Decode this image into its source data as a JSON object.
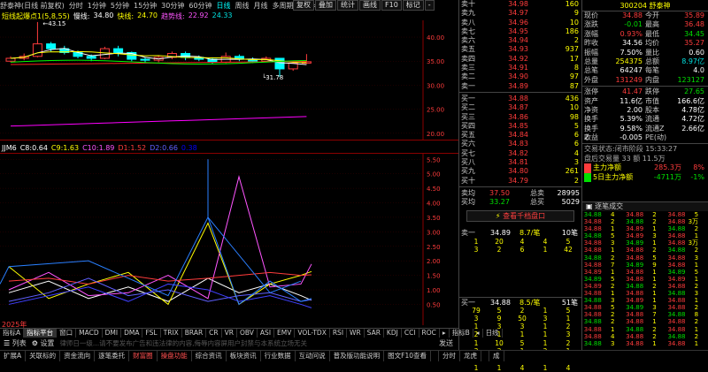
{
  "topbar": {
    "stock": "舒泰神(日线 前复权)",
    "periods": [
      "分时",
      "1分钟",
      "5分钟",
      "15分钟",
      "30分钟",
      "60分钟",
      "日线",
      "周线",
      "月线",
      "多周期",
      "更多>"
    ],
    "active": "日线",
    "right_tabs": [
      "复权",
      "叠加",
      "统计",
      "画线",
      "F10",
      "标记",
      "-"
    ]
  },
  "indicator": {
    "name": "短线起爆点1(5,8,55)",
    "slow_label": "慢线:",
    "slow": "34.80",
    "fast_label": "快线:",
    "fast": "24.70",
    "trend_label": "趋势线:",
    "trend": "22.92",
    "extra": "24.33"
  },
  "subind": {
    "name": "JJM6",
    "items": [
      {
        "label": "C8:",
        "value": "0.64",
        "color": "#ffffff"
      },
      {
        "label": "C9:",
        "value": "1.63",
        "color": "#ffff00"
      },
      {
        "label": "C10:",
        "value": "1.89",
        "color": "#ff55ff"
      },
      {
        "label": "D1:",
        "value": "1.52",
        "color": "#ff3c3c"
      },
      {
        "label": "D2:",
        "value": "0.66",
        "color": "#6060ff"
      },
      {
        "label": "",
        "value": "0.38",
        "color": "#0000ff"
      }
    ]
  },
  "main_axis": [
    "40.00",
    "35.00",
    "30.00",
    "25.00",
    "20.00"
  ],
  "sub_axis": [
    "5.50",
    "5.00",
    "4.50",
    "4.00",
    "3.50",
    "3.00",
    "2.50",
    "2.00",
    "1.50",
    "1.00",
    "0.50"
  ],
  "annot": {
    "high": "43.15",
    "low": "31.78"
  },
  "year": "2025年",
  "tabs1": [
    "指标A",
    "指标平台",
    "窗口",
    "MACD",
    "DMI",
    "DMA",
    "FSL",
    "TRIX",
    "BRAR",
    "CR",
    "VR",
    "OBV",
    "ASI",
    "EMV",
    "VOL-TDX",
    "RSI",
    "WR",
    "SAR",
    "KDJ",
    "CCI",
    "ROC",
    "▸",
    "指标B",
    "◂"
  ],
  "tabs1_right": "日线",
  "tabs2": {
    "list": "列表",
    "settings": "设置",
    "ticker": "律师日一级...请不要发布广告和违法律的内容,侮辱内容屏用户封禁与本系统立场无关",
    "send": "发送"
  },
  "bottombar": [
    "扩展A",
    "关联标的",
    "资金流向",
    "逐笔委托",
    "财富圈",
    "操盘功能",
    "综合资讯",
    "板块资讯",
    "行业数据",
    "互动问说",
    "普及版功能说明",
    "图文F10查看",
    "",
    "分时",
    "龙虎",
    "",
    "成"
  ],
  "book": {
    "sell": [
      {
        "l": "卖十",
        "p": "34.98",
        "v": "160"
      },
      {
        "l": "卖九",
        "p": "34.97",
        "v": "9"
      },
      {
        "l": "卖八",
        "p": "34.96",
        "v": "10"
      },
      {
        "l": "卖七",
        "p": "34.95",
        "v": "186"
      },
      {
        "l": "卖六",
        "p": "34.94",
        "v": "2"
      },
      {
        "l": "卖五",
        "p": "34.93",
        "v": "937"
      },
      {
        "l": "卖四",
        "p": "34.92",
        "v": "17"
      },
      {
        "l": "卖三",
        "p": "34.91",
        "v": "8"
      },
      {
        "l": "卖二",
        "p": "34.90",
        "v": "97"
      },
      {
        "l": "卖一",
        "p": "34.89",
        "v": "87"
      }
    ],
    "buy": [
      {
        "l": "买一",
        "p": "34.88",
        "v": "436"
      },
      {
        "l": "买二",
        "p": "34.87",
        "v": "10"
      },
      {
        "l": "买三",
        "p": "34.86",
        "v": "98"
      },
      {
        "l": "买四",
        "p": "34.85",
        "v": "5"
      },
      {
        "l": "买五",
        "p": "34.84",
        "v": "6"
      },
      {
        "l": "买六",
        "p": "34.83",
        "v": "6"
      },
      {
        "l": "买七",
        "p": "34.82",
        "v": "4"
      },
      {
        "l": "买八",
        "p": "34.81",
        "v": "3"
      },
      {
        "l": "买九",
        "p": "34.80",
        "v": "261"
      },
      {
        "l": "买十",
        "p": "34.79",
        "v": "2"
      }
    ],
    "avg": [
      {
        "l": "卖均",
        "p": "37.50",
        "m": "总卖",
        "v": "28995"
      },
      {
        "l": "买均",
        "p": "33.27",
        "m": "总买",
        "v": "5029"
      }
    ]
  },
  "quote": {
    "code": "300204",
    "name": "舒泰神",
    "rows": [
      {
        "a": "现价",
        "b": "34.88",
        "bc": "#ff3c3c",
        "c": "今开",
        "d": "35.89",
        "dc": "#ff3c3c"
      },
      {
        "a": "涨跌",
        "b": "-0.01",
        "bc": "#00e000",
        "c": "最高",
        "d": "36.48",
        "dc": "#ff3c3c"
      },
      {
        "a": "涨幅",
        "b": "0.93%",
        "bc": "#ff3c3c",
        "c": "最低",
        "d": "34.45",
        "dc": "#00e000"
      },
      {
        "a": "昨收",
        "b": "34.56",
        "bc": "#fff",
        "c": "均价",
        "d": "35.27",
        "dc": "#ff3c3c"
      },
      {
        "a": "振幅",
        "b": "7.50%",
        "bc": "#fff",
        "c": "量比",
        "d": "0.60",
        "dc": "#fff"
      },
      {
        "a": "总量",
        "b": "254375",
        "bc": "#ffff00",
        "c": "总额",
        "d": "8.97亿",
        "dc": "#00e0e0"
      },
      {
        "a": "总笔",
        "b": "64247",
        "bc": "#fff",
        "c": "每笔",
        "d": "4.0",
        "dc": "#fff"
      },
      {
        "a": "外盘",
        "b": "131249",
        "bc": "#ff3c3c",
        "c": "内盘",
        "d": "123127",
        "dc": "#00e000"
      }
    ],
    "rows2": [
      {
        "a": "涨停",
        "b": "41.47",
        "bc": "#ff3c3c",
        "c": "跌停",
        "d": "27.65",
        "dc": "#00e000"
      },
      {
        "a": "资产",
        "b": "11.6亿",
        "bc": "#fff",
        "c": "市值",
        "d": "166.6亿",
        "dc": "#fff"
      },
      {
        "a": "净资",
        "b": "2.00",
        "bc": "#fff",
        "c": "股本",
        "d": "4.78亿",
        "dc": "#fff"
      },
      {
        "a": "换手",
        "b": "5.39%",
        "bc": "#fff",
        "c": "流通",
        "d": "4.72亿",
        "dc": "#fff"
      },
      {
        "a": "换手Z",
        "b": "9.58%",
        "bc": "#fff",
        "c": "流通Z",
        "d": "2.66亿",
        "dc": "#fff"
      },
      {
        "a": "收益",
        "b": "-0.005",
        "bc": "#fff",
        "c": "PE(动)",
        "d": "",
        "dc": "#fff"
      }
    ],
    "status": "交易状态:闭市阶段 15:33:27",
    "after": "盘后交易量 33 额 11.5万",
    "mainflow_label": "主力净额",
    "mainflow_v": "285.3万",
    "mainflow_p": "8%",
    "flow5_label": "5日主力净额",
    "flow5_v": "-4711万",
    "flow5_p": "-1%"
  },
  "qd": {
    "btn": "查看千档盘口",
    "sell_h": {
      "l": "卖一",
      "p": "34.89",
      "n": "8.7/笔",
      "c": "10笔"
    },
    "sell_g": [
      [
        "1",
        "20",
        "4",
        "4",
        "5"
      ],
      [
        "3",
        "2",
        "6",
        "1",
        "42"
      ]
    ],
    "buy_h": {
      "l": "买一",
      "p": "34.88",
      "n": "8.5/笔",
      "c": "51笔"
    },
    "buy_g": [
      [
        "79",
        "5",
        "2",
        "1",
        "5"
      ],
      [
        "3",
        "9",
        "50",
        "3",
        "1"
      ],
      [
        "1",
        "3",
        "3",
        "1",
        "2"
      ],
      [
        "2",
        "1",
        "1",
        "1",
        "3"
      ],
      [
        "1",
        "10",
        "5",
        "1",
        "2"
      ],
      [
        "3",
        "3",
        "1",
        "2",
        "1"
      ],
      [
        "1",
        "4",
        "2",
        "2",
        "1"
      ],
      [
        "1",
        "1",
        "4",
        "1",
        "4"
      ]
    ]
  },
  "ticks": {
    "title": "逐笔成交",
    "cols": [
      [
        "34.88",
        "34.88",
        "34.88",
        "34.88",
        "34.88",
        "34.88",
        "34.88",
        "34.88",
        "34.89",
        "34.89",
        "34.89",
        "34.88",
        "34.88",
        "34.88",
        "34.88",
        "34.88",
        "34.88",
        "34.88",
        "34.88"
      ],
      [
        "4",
        "2",
        "1",
        "5",
        "3",
        "1",
        "2",
        "7",
        "1",
        "5",
        "2",
        "1",
        "3",
        "5",
        "2",
        "2",
        "1",
        "4",
        "3"
      ],
      [
        "34.88",
        "34.88",
        "34.89",
        "34.89",
        "34.89",
        "34.88",
        "34.88",
        "34.89",
        "34.88",
        "34.88",
        "34.88",
        "34.88",
        "34.89",
        "34.89",
        "34.88",
        "34.88",
        "34.88",
        "34.88",
        "34.88"
      ],
      [
        "2",
        "2",
        "1",
        "3",
        "1",
        "2",
        "5",
        "9",
        "1",
        "1",
        "2",
        "1",
        "1",
        "3",
        "7",
        "1",
        "2",
        "2",
        "1"
      ],
      [
        "34.88",
        "34.88",
        "34.88",
        "34.88",
        "34.88",
        "34.88",
        "34.88",
        "34.88",
        "34.89",
        "34.89",
        "34.88",
        "34.88",
        "34.88",
        "34.88",
        "34.88",
        "34.88",
        "34.88",
        "34.88",
        "34.88"
      ],
      [
        "5",
        "3万",
        "2",
        "1",
        "3万",
        "2",
        "3",
        "1",
        "5",
        "1",
        "2",
        "3",
        "1",
        "2",
        "8",
        "2",
        "1",
        "2",
        "1"
      ]
    ]
  },
  "candles": [
    {
      "o": 35.0,
      "c": 35.6,
      "h": 36.0,
      "l": 34.8
    },
    {
      "o": 35.6,
      "c": 36.0,
      "h": 36.6,
      "l": 35.2
    },
    {
      "o": 36.0,
      "c": 38.6,
      "h": 43.15,
      "l": 35.8
    },
    {
      "o": 38.6,
      "c": 37.6,
      "h": 39.0,
      "l": 37.0
    },
    {
      "o": 37.6,
      "c": 36.8,
      "h": 38.2,
      "l": 36.4
    },
    {
      "o": 36.8,
      "c": 36.0,
      "h": 37.2,
      "l": 35.6
    },
    {
      "o": 36.0,
      "c": 35.6,
      "h": 36.4,
      "l": 35.0
    },
    {
      "o": 35.6,
      "c": 37.6,
      "h": 38.0,
      "l": 35.4
    },
    {
      "o": 37.6,
      "c": 36.8,
      "h": 38.2,
      "l": 36.0
    },
    {
      "o": 36.8,
      "c": 35.4,
      "h": 37.0,
      "l": 35.0
    },
    {
      "o": 35.4,
      "c": 35.2,
      "h": 35.8,
      "l": 34.6
    },
    {
      "o": 35.2,
      "c": 35.8,
      "h": 36.2,
      "l": 34.8
    },
    {
      "o": 35.8,
      "c": 36.6,
      "h": 37.0,
      "l": 35.4
    },
    {
      "o": 36.6,
      "c": 35.8,
      "h": 37.0,
      "l": 35.2
    },
    {
      "o": 35.8,
      "c": 35.4,
      "h": 36.2,
      "l": 35.0
    },
    {
      "o": 35.4,
      "c": 34.8,
      "h": 35.8,
      "l": 34.4
    },
    {
      "o": 34.8,
      "c": 36.0,
      "h": 36.8,
      "l": 34.6
    },
    {
      "o": 36.0,
      "c": 35.4,
      "h": 36.4,
      "l": 35.0
    },
    {
      "o": 35.4,
      "c": 35.0,
      "h": 35.8,
      "l": 34.6
    },
    {
      "o": 35.0,
      "c": 35.6,
      "h": 36.0,
      "l": 34.8
    },
    {
      "o": 35.6,
      "c": 33.4,
      "h": 35.6,
      "l": 31.78
    },
    {
      "o": 33.4,
      "c": 34.6,
      "h": 35.0,
      "l": 33.0
    },
    {
      "o": 34.6,
      "c": 34.88,
      "h": 36.48,
      "l": 34.45
    }
  ]
}
